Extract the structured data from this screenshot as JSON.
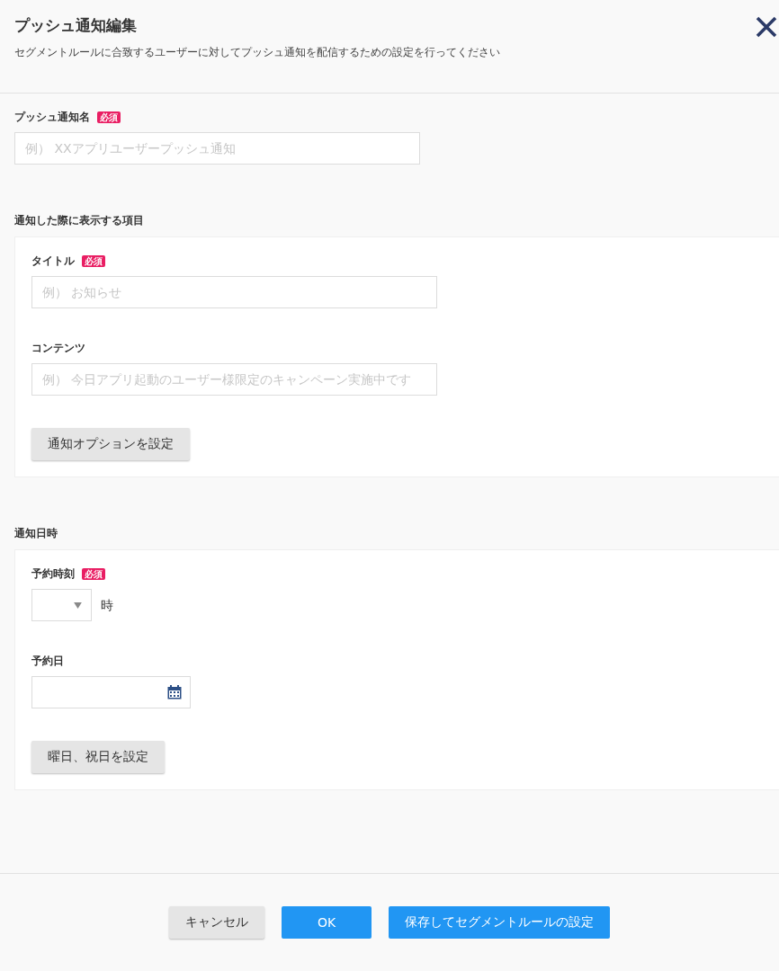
{
  "header": {
    "title": "プッシュ通知編集",
    "subtitle": "セグメントルールに合致するユーザーに対してプッシュ通知を配信するための設定を行ってください"
  },
  "sections": [
    {
      "kind": "plain",
      "fields": [
        {
          "kind": "text",
          "label": "プッシュ通知名",
          "badge": "必須",
          "placeholder": "例） XXアプリユーザープッシュ通知"
        }
      ]
    },
    {
      "kind": "card",
      "heading": "通知した際に表示する項目",
      "fields": [
        {
          "kind": "text",
          "label": "タイトル",
          "badge": "必須",
          "placeholder": "例） お知らせ"
        },
        {
          "kind": "text",
          "label": "コンテンツ",
          "placeholder": "例） 今日アプリ起動のユーザー様限定のキャンペーン実施中です"
        }
      ],
      "button": "通知オプションを設定"
    },
    {
      "kind": "card",
      "heading": "通知日時",
      "fields": [
        {
          "kind": "select",
          "label": "予約時刻",
          "badge": "必須",
          "unit": "時"
        },
        {
          "kind": "date",
          "label": "予約日"
        }
      ],
      "button": "曜日、祝日を設定"
    }
  ],
  "footer": {
    "buttons": [
      {
        "kind": "secondary",
        "label": "キャンセル"
      },
      {
        "kind": "primary",
        "label": "OK"
      },
      {
        "kind": "primary",
        "label": "保存してセグメントルールの設定"
      }
    ]
  }
}
